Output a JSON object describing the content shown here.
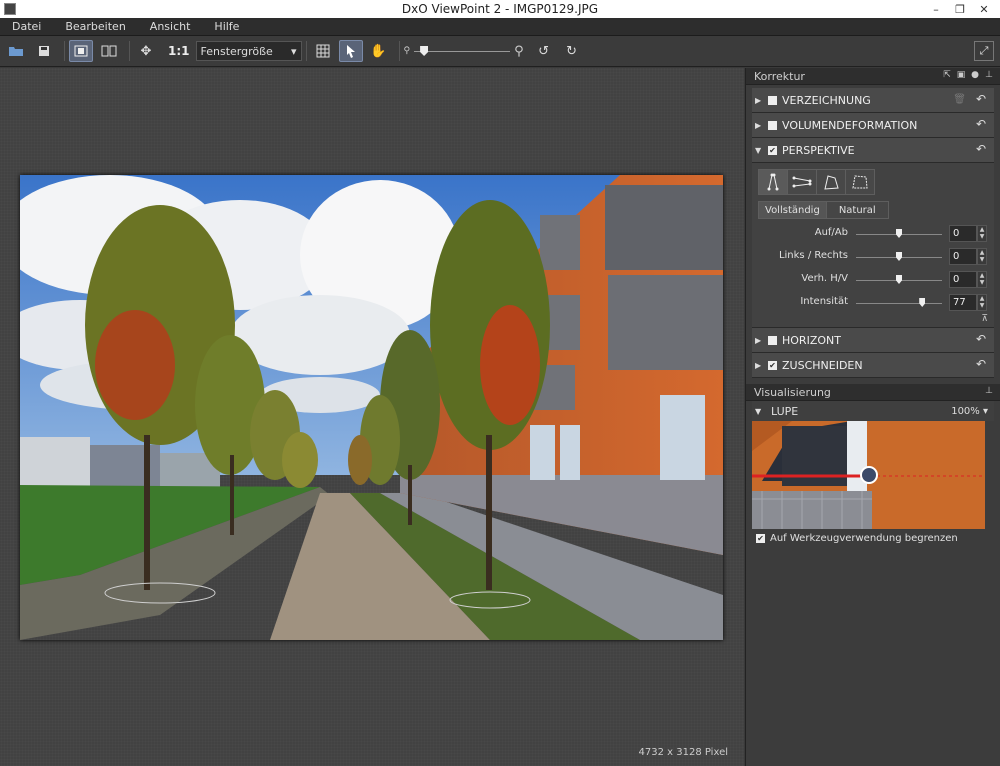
{
  "window": {
    "title": "DxO ViewPoint 2 - IMGP0129.JPG",
    "controls": [
      "–",
      "❐",
      "✕"
    ]
  },
  "menu": [
    "Datei",
    "Bearbeiten",
    "Ansicht",
    "Hilfe"
  ],
  "toolbar": {
    "one_to_one": "1:1",
    "zoom_select": "Fenstergröße"
  },
  "canvas": {
    "pixel_info": "4732 x 3128 Pixel"
  },
  "panel": {
    "korrektur_title": "Korrektur",
    "sections": {
      "verzeichnung": "VERZEICHNUNG",
      "volumendeformation": "VOLUMENDEFORMATION",
      "perspektive": "PERSPEKTIVE",
      "horizont": "HORIZONT",
      "zuschneiden": "ZUSCHNEIDEN"
    },
    "perspektive": {
      "modes": [
        "Vollständig",
        "Natural"
      ],
      "sliders": [
        {
          "label": "Auf/Ab",
          "value": "0",
          "level": 0.5
        },
        {
          "label": "Links / Rechts",
          "value": "0",
          "level": 0.5
        },
        {
          "label": "Verh. H/V",
          "value": "0",
          "level": 0.5
        },
        {
          "label": "Intensität",
          "value": "77",
          "level": 0.77
        }
      ]
    },
    "visualisierung_title": "Visualisierung",
    "lupe": {
      "label": "LUPE",
      "zoom": "100%",
      "limit_label": "Auf Werkzeugverwendung begrenzen"
    }
  }
}
